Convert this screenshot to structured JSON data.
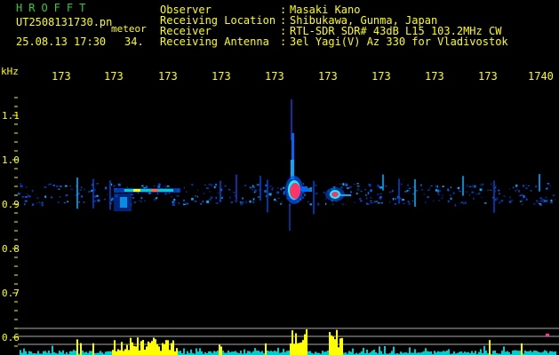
{
  "header": {
    "logo": "HROFFT",
    "filename": "UT2508131730.pn",
    "meteor_label": "meteor",
    "datetime": "25.08.13 17:30",
    "count": "34.",
    "observer_label": "Observer",
    "observer_value": "Masaki Kano",
    "location_label": "Receiving Location",
    "location_value": "Shibukawa, Gunma, Japan",
    "receiver_label": "Receiver",
    "receiver_value": "RTL-SDR SDR# 43dB L15 103.2MHz CW",
    "antenna_label": "Receiving Antenna",
    "antenna_value": "3el Yagi(V) Az 330 for Vladivostok",
    "colon": ":"
  },
  "axis": {
    "khz_label": "kHz",
    "freq_ticks": [
      "173",
      "173",
      "173",
      "173",
      "173",
      "173",
      "173",
      "173",
      "173",
      "1740"
    ],
    "y_ticks": [
      "1.1",
      "1.0",
      "0.9",
      "0.8",
      "0.7",
      "0.6"
    ]
  },
  "colors": {
    "background": "#000000",
    "text": "#ffff00",
    "logo": "#33cc33",
    "spectrum_hot": "#ff3366",
    "spectrum_warm": "#ffff00",
    "spectrum_mid": "#00ffff",
    "spectrum_low": "#0044cc",
    "histogram_yellow": "#ffff00",
    "histogram_cyan": "#00cccc",
    "grid_lines": "#aaaaaa"
  }
}
